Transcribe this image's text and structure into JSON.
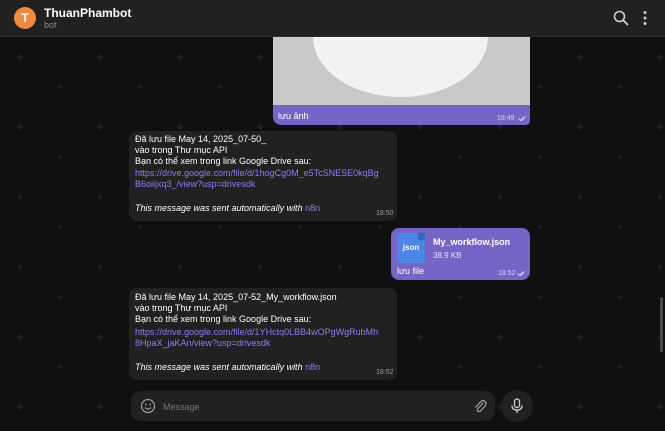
{
  "header": {
    "avatar_letter": "T",
    "title": "ThuanPhambot",
    "subtitle": "bot",
    "avatar_color": "#f08a3e"
  },
  "messages": [
    {
      "id": "photo",
      "direction": "outgoing",
      "caption": "lưu ảnh",
      "time": "18:49"
    },
    {
      "id": "msg1",
      "direction": "incoming",
      "line1": "Đã lưu file  May 14, 2025_07-50_",
      "line2": " vào trong Thư mục API",
      "line3": "Bạn có thể xem trong link Google Drive sau:",
      "link_line1": "https://drive.google.com/file/d/1hogCg0M_e5TcSNESE0kqBg",
      "link_line2": "B6oiijxq3_/view?usp=drivesdk",
      "footer": "This message was sent automatically with ",
      "footer_link": "n8n",
      "time": "18:50"
    },
    {
      "id": "file",
      "direction": "outgoing",
      "file_type": "json",
      "file_name": "My_workflow.json",
      "file_size": "38.9 KB",
      "caption": "lưu file",
      "time": "18:52"
    },
    {
      "id": "msg2",
      "direction": "incoming",
      "line1": "Đã lưu file  May 14, 2025_07-52_My_workflow.json",
      "line2": " vào trong Thư mục API",
      "line3": "Bạn có thể xem trong link Google Drive sau:",
      "link_line1": "https://drive.google.com/file/d/1YHctq0LBB4wOPgWgRubMh",
      "link_line2": "8HpaX_jaKAn/view?usp=drivesdk",
      "footer": "This message was sent automatically with ",
      "footer_link": "n8n",
      "time": "18:52"
    }
  ],
  "composer": {
    "placeholder": "Message"
  },
  "colors": {
    "outgoing_bubble": "#7665c7",
    "incoming_bubble": "#212121",
    "link": "#8e7ff0"
  },
  "icons": [
    "search-icon",
    "more-vertical-icon",
    "emoji-icon",
    "attach-icon",
    "mic-icon",
    "double-check-icon"
  ]
}
